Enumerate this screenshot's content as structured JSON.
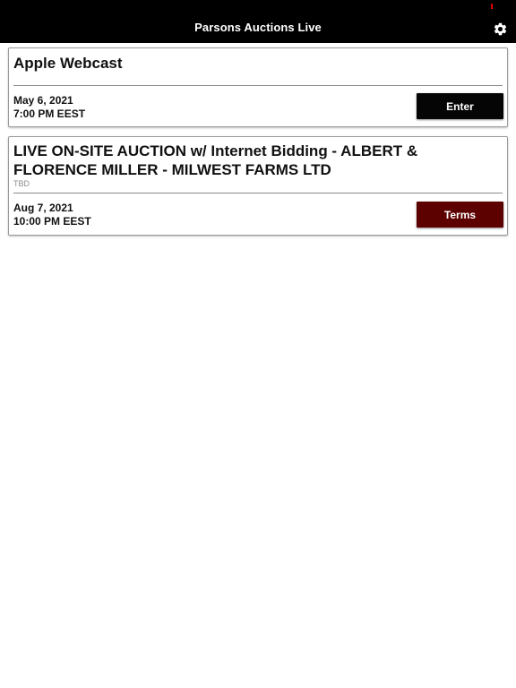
{
  "header": {
    "title": "Parsons Auctions Live",
    "settings_icon": "gear-icon",
    "indicator_color": "#e00000"
  },
  "auctions": [
    {
      "title": "Apple Webcast",
      "subtitle": "",
      "date": "May 6, 2021",
      "time": "7:00 PM EEST",
      "button_label": "Enter",
      "button_color": "#050505"
    },
    {
      "title": "LIVE ON-SITE AUCTION w/ Internet Bidding - ALBERT & FLORENCE MILLER - MILWEST FARMS LTD",
      "subtitle": "TBD",
      "date": "Aug 7, 2021",
      "time": "10:00 PM EEST",
      "button_label": "Terms",
      "button_color": "#5c0000"
    }
  ]
}
